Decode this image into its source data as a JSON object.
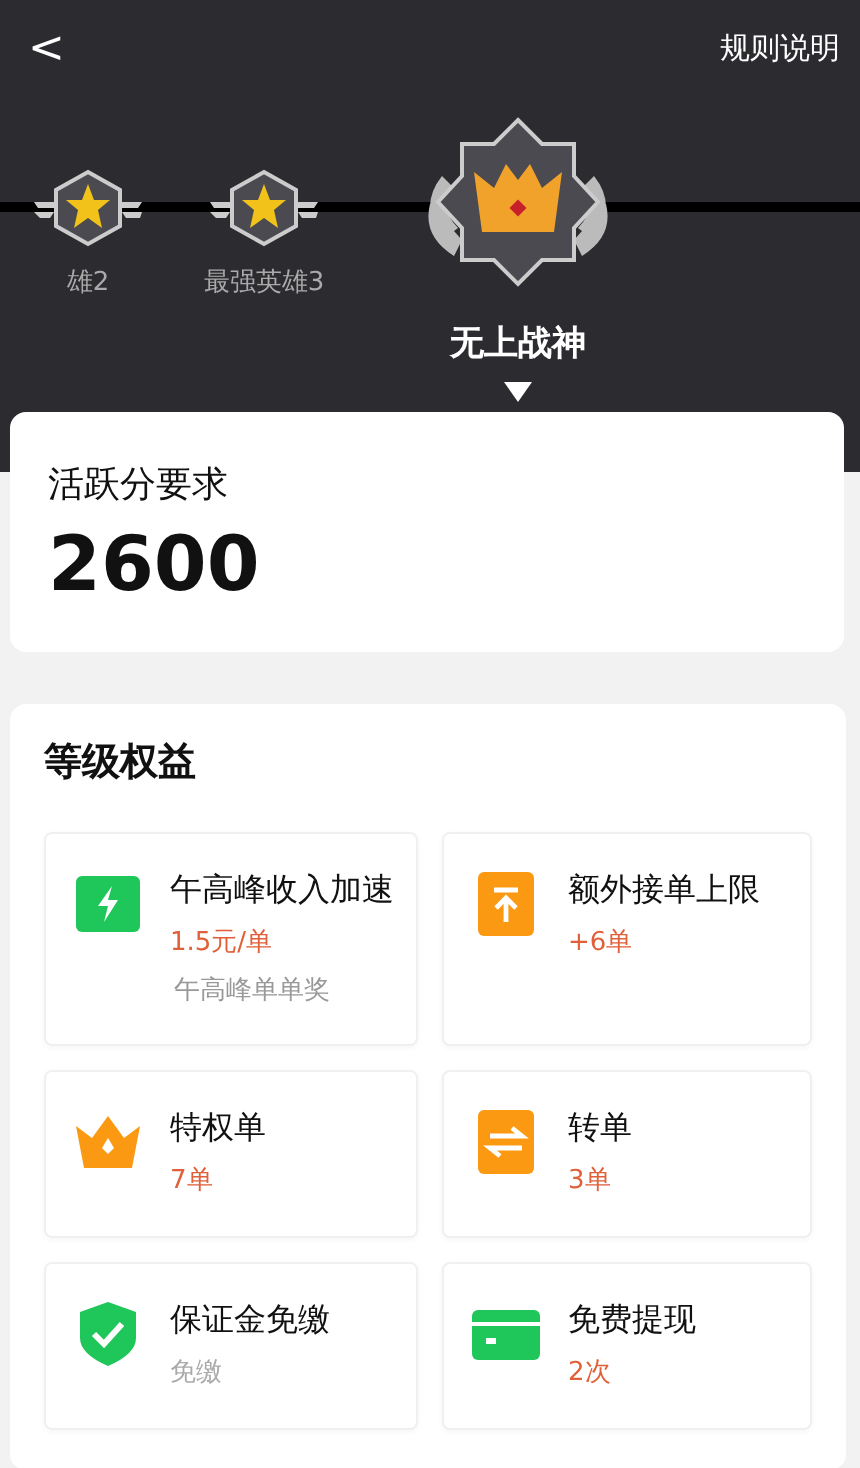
{
  "nav": {
    "back": "<",
    "rules_link": "规则说明"
  },
  "levels": [
    {
      "label": "雄2",
      "selected": false,
      "kind": "star"
    },
    {
      "label": "最强英雄3",
      "selected": false,
      "kind": "star"
    },
    {
      "label": "无上战神",
      "selected": true,
      "kind": "crown"
    }
  ],
  "requirement": {
    "label": "活跃分要求",
    "value": "2600"
  },
  "benefits": {
    "title": "等级权益",
    "items": [
      {
        "kind": "bolt",
        "name": "午高峰收入加速",
        "value": "1.5元/单",
        "highlighted": true,
        "note": "午高峰单单奖"
      },
      {
        "kind": "raise",
        "name": "额外接单上限",
        "value": "+6单",
        "highlighted": true
      },
      {
        "kind": "crown",
        "name": "特权单",
        "value": "7单",
        "highlighted": true
      },
      {
        "kind": "swap",
        "name": "转单",
        "value": "3单",
        "highlighted": true
      },
      {
        "kind": "shield",
        "name": "保证金免缴",
        "value": "免缴",
        "highlighted": false
      },
      {
        "kind": "card",
        "name": "免费提现",
        "value": "2次",
        "highlighted": true
      }
    ]
  }
}
